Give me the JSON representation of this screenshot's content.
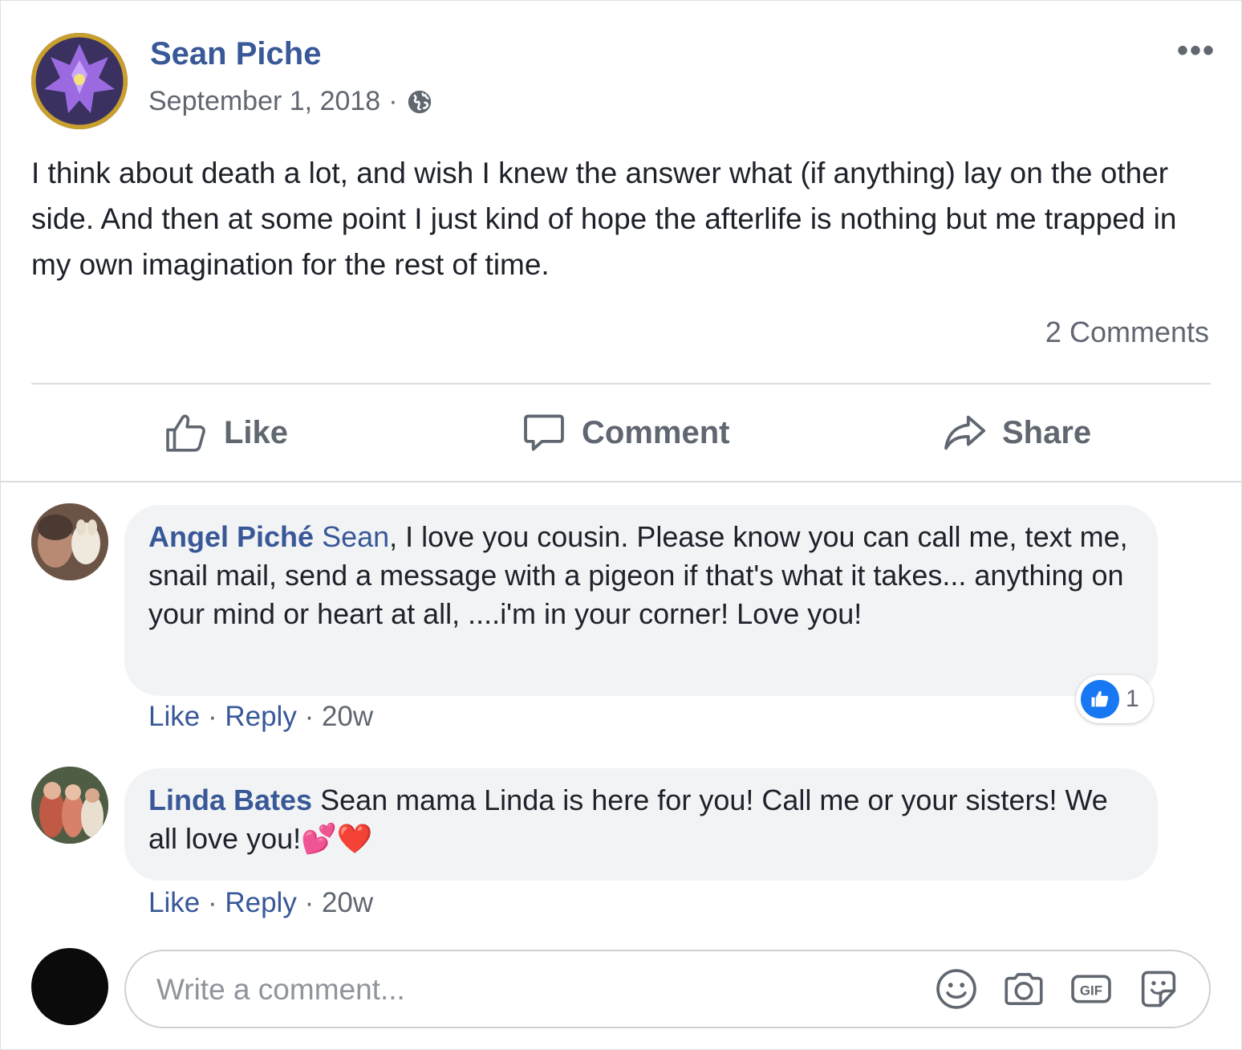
{
  "post": {
    "author": "Sean Piche",
    "date": "September 1, 2018",
    "separator": "·",
    "more_label": "•••",
    "text": "I think about death a lot, and wish I knew the answer what (if anything) lay on the other side. And then at some point I just kind of hope the afterlife is nothing but me trapped in my own imagination for the rest of time.",
    "comment_count": "2 Comments",
    "privacy_icon": "globe-icon"
  },
  "actions": {
    "like": "Like",
    "comment": "Comment",
    "share": "Share"
  },
  "comments": [
    {
      "author": "Angel Piché",
      "mention": "Sean",
      "text": ", I love you cousin. Please know you can call me, text me, snail mail, send a message with a pigeon if that's what it takes... anything on your mind or heart at all, ....i'm in your corner! Love you!",
      "like": "Like",
      "reply": "Reply",
      "time": "20w",
      "reactions": "1"
    },
    {
      "author": "Linda Bates",
      "text": "Sean mama Linda is here for you! Call me or your sisters! We all love you!💕❤️",
      "like": "Like",
      "reply": "Reply",
      "time": "20w"
    }
  ],
  "composer": {
    "placeholder": "Write a comment...",
    "gif_label": "GIF"
  },
  "colors": {
    "link_blue": "#385898",
    "meta_gray": "#606770",
    "bubble_bg": "#f2f3f5",
    "reaction_blue": "#1877f2"
  }
}
